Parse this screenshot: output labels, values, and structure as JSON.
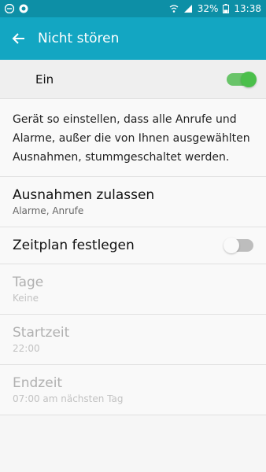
{
  "status": {
    "battery": "32%",
    "time": "13:38"
  },
  "header": {
    "title": "Nicht stören"
  },
  "master": {
    "label": "Ein",
    "enabled": true
  },
  "description": "Gerät so einstellen, dass alle Anrufe und Alarme, außer die von Ihnen ausgewählten Ausnahmen, stummgeschaltet werden.",
  "items": [
    {
      "title": "Ausnahmen zulassen",
      "subtitle": "Alarme, Anrufe"
    },
    {
      "title": "Zeitplan festlegen",
      "toggle_on": false
    },
    {
      "title": "Tage",
      "subtitle": "Keine"
    },
    {
      "title": "Startzeit",
      "subtitle": "22:00"
    },
    {
      "title": "Endzeit",
      "subtitle": "07:00 am nächsten Tag"
    }
  ],
  "colors": {
    "statusbar": "#0d8fa6",
    "appbar": "#13a6c2",
    "switch_on": "#4bbf4b"
  }
}
